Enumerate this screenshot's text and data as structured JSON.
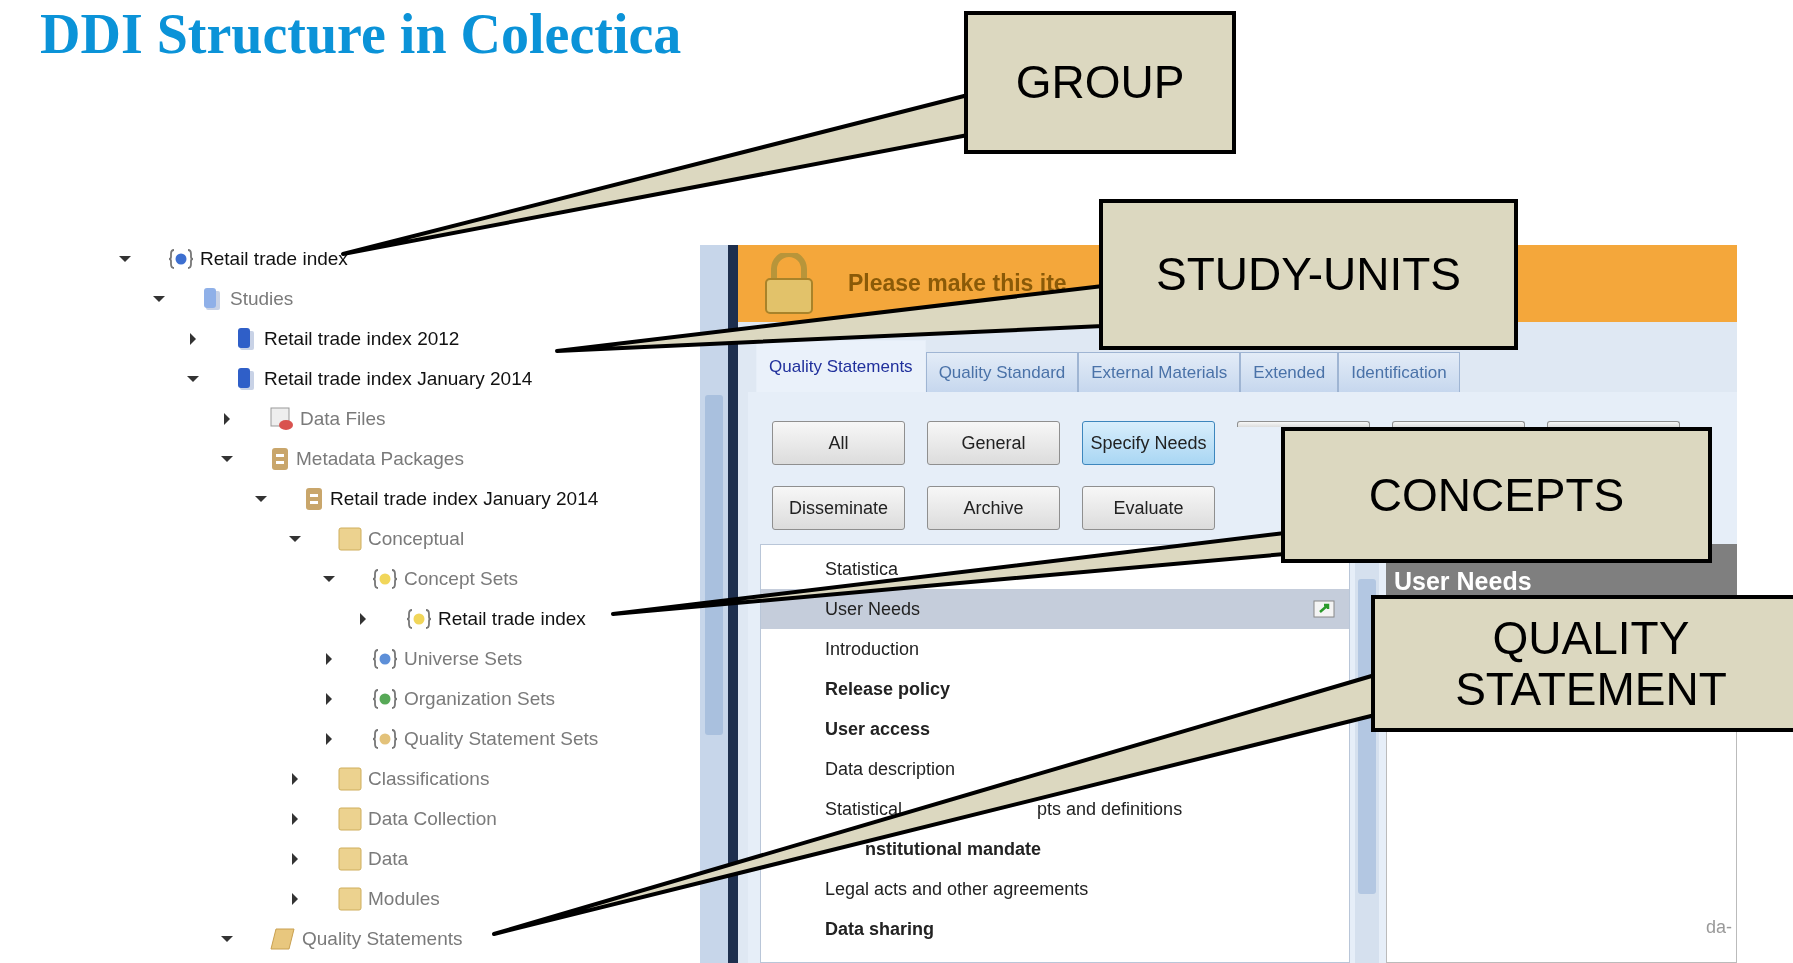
{
  "title": "DDI Structure in Colectica",
  "tree": [
    {
      "label": "Retail trade index",
      "kind": "group",
      "dimmed": false,
      "expanded": true,
      "children": [
        {
          "label": "Studies",
          "kind": "studies",
          "dimmed": true,
          "expanded": true,
          "children": [
            {
              "label": "Retail trade index 2012",
              "kind": "study",
              "dimmed": false,
              "expanded": false
            },
            {
              "label": "Retail trade index January 2014",
              "kind": "study",
              "dimmed": false,
              "expanded": true,
              "children": [
                {
                  "label": "Data Files",
                  "kind": "datafile",
                  "dimmed": true,
                  "expanded": false
                },
                {
                  "label": "Metadata Packages",
                  "kind": "package",
                  "dimmed": true,
                  "expanded": true,
                  "children": [
                    {
                      "label": "Retail trade index January 2014",
                      "kind": "package",
                      "dimmed": false,
                      "expanded": true,
                      "children": [
                        {
                          "label": "Conceptual",
                          "kind": "folder",
                          "dimmed": true,
                          "expanded": true,
                          "children": [
                            {
                              "label": "Concept Sets",
                              "kind": "conceptset",
                              "dimmed": true,
                              "expanded": true,
                              "children": [
                                {
                                  "label": "Retail trade index",
                                  "kind": "conceptset",
                                  "dimmed": false,
                                  "expanded": false
                                }
                              ]
                            },
                            {
                              "label": "Universe Sets",
                              "kind": "universeset",
                              "dimmed": true,
                              "expanded": false
                            },
                            {
                              "label": "Organization Sets",
                              "kind": "orgset",
                              "dimmed": true,
                              "expanded": false
                            },
                            {
                              "label": "Quality Statement Sets",
                              "kind": "qualityset",
                              "dimmed": true,
                              "expanded": false
                            }
                          ]
                        },
                        {
                          "label": "Classifications",
                          "kind": "folder",
                          "dimmed": true,
                          "expanded": false
                        },
                        {
                          "label": "Data Collection",
                          "kind": "folder",
                          "dimmed": true,
                          "expanded": false
                        },
                        {
                          "label": "Data",
                          "kind": "folder",
                          "dimmed": true,
                          "expanded": false
                        },
                        {
                          "label": "Modules",
                          "kind": "folder",
                          "dimmed": true,
                          "expanded": false
                        }
                      ]
                    }
                  ]
                },
                {
                  "label": "Quality Statements",
                  "kind": "scroll",
                  "dimmed": true,
                  "expanded": true
                }
              ]
            }
          ]
        }
      ]
    }
  ],
  "app": {
    "banner": "Please make this ite",
    "tabs": [
      {
        "label": "Quality Statements",
        "selected": true
      },
      {
        "label": "Quality Standard",
        "selected": false
      },
      {
        "label": "External Materials",
        "selected": false
      },
      {
        "label": "Extended",
        "selected": false
      },
      {
        "label": "Identification",
        "selected": false
      }
    ],
    "filter_buttons": [
      {
        "label": "All",
        "selected": false
      },
      {
        "label": "General",
        "selected": false
      },
      {
        "label": "Specify Needs",
        "selected": true
      },
      {
        "selected": false
      },
      {
        "selected": false
      },
      {
        "selected": false
      },
      {
        "label": "Disseminate",
        "selected": false
      },
      {
        "label": "Archive",
        "selected": false
      },
      {
        "label": "Evaluate",
        "selected": false
      }
    ],
    "statements": [
      {
        "text": "Statistica",
        "bold": false,
        "selected": false
      },
      {
        "text": "User Needs",
        "bold": false,
        "selected": true
      },
      {
        "text": "Introduction",
        "bold": false,
        "selected": false
      },
      {
        "text": "Release policy",
        "bold": true,
        "selected": false
      },
      {
        "text": "User access",
        "bold": true,
        "selected": false
      },
      {
        "text": "Data description",
        "bold": false,
        "selected": false
      },
      {
        "text": "Statistical",
        "text_after_cover": "pts and definitions",
        "bold": false,
        "selected": false
      },
      {
        "text": "nstitutional mandate",
        "bold": true,
        "selected": false,
        "covered_start": true
      },
      {
        "text": "Legal acts and other agreements",
        "bold": false,
        "selected": false
      },
      {
        "text": "Data sharing",
        "bold": true,
        "selected": false
      }
    ],
    "detail": {
      "heading": "User Needs",
      "text": "da-"
    }
  },
  "callouts": [
    {
      "label": "GROUP"
    },
    {
      "label": "STUDY-UNITS"
    },
    {
      "label": "CONCEPTS"
    },
    {
      "label": "QUALITY STATEMENT"
    }
  ]
}
